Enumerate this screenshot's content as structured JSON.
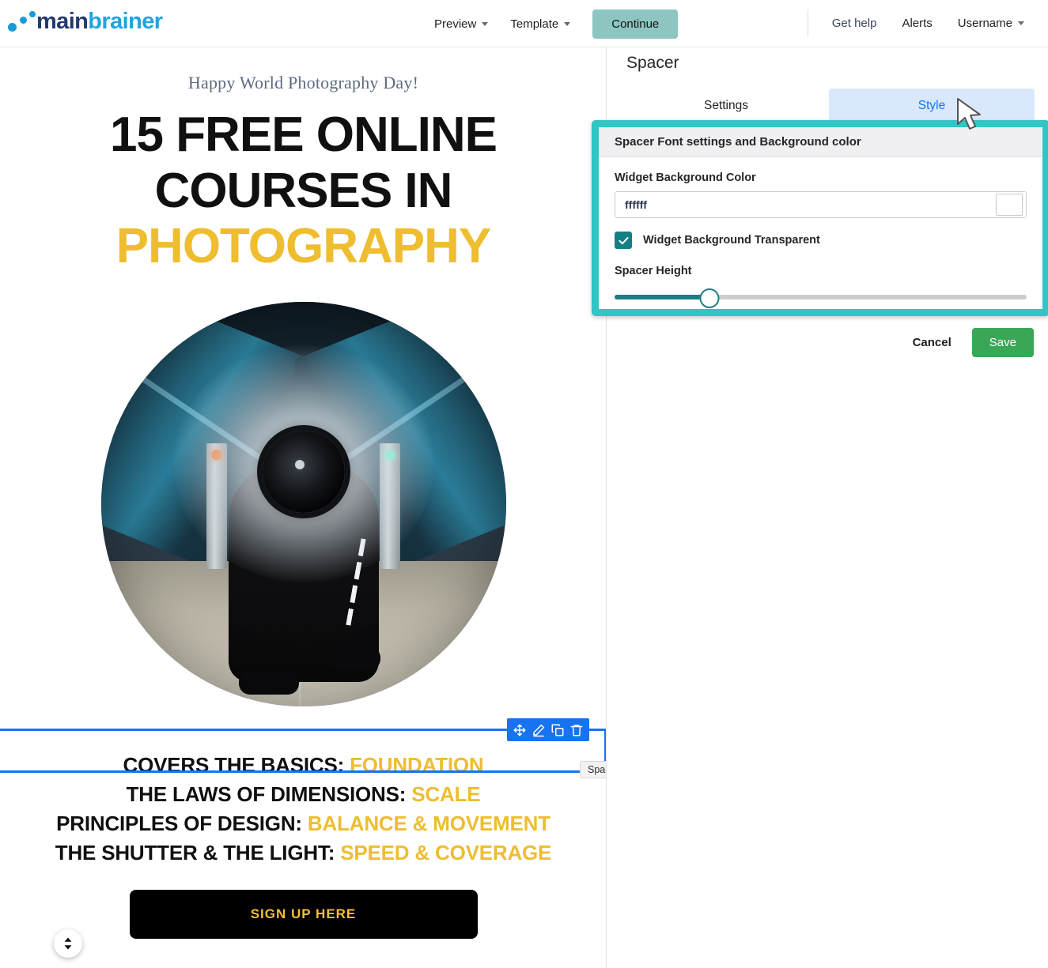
{
  "brand": {
    "name_part1": "main",
    "name_part2": "brainer",
    "dot_color": "#1a9bd7",
    "navy": "#233a6c",
    "blue": "#1fa5e0"
  },
  "topnav": {
    "preview_label": "Preview",
    "template_label": "Template",
    "continue_label": "Continue",
    "continue_bg": "#8dc6c0",
    "get_help_label": "Get help",
    "alerts_label": "Alerts",
    "username_label": "Username"
  },
  "email": {
    "kicker": "Happy World Photography Day!",
    "headline_line1": "15 FREE ONLINE",
    "headline_line2": "COURSES IN",
    "headline_line3": "PHOTOGRAPHY",
    "gold": "#eebd30",
    "photo_alt": "photographer-crouching-in-metro-station",
    "bullets": [
      {
        "dark": "COVERS THE BASICS:",
        "gold": "FOUNDATION"
      },
      {
        "dark": "THE LAWS OF DIMENSIONS:",
        "gold": "SCALE"
      },
      {
        "dark": "PRINCIPLES OF DESIGN:",
        "gold": "BALANCE & MOVEMENT"
      },
      {
        "dark": "THE SHUTTER & THE LIGHT:",
        "gold": "SPEED & COVERAGE"
      }
    ],
    "cta_label": "SIGN UP HERE"
  },
  "selection": {
    "widget_label": "Spacer",
    "outline_color": "#1773f0",
    "toolbar_icons": [
      "move-icon",
      "edit-pencil-icon",
      "duplicate-icon",
      "trash-icon"
    ]
  },
  "panel": {
    "title": "Spacer",
    "tabs": [
      {
        "label": "Settings",
        "active": false
      },
      {
        "label": "Style",
        "active": true
      }
    ],
    "card_header": "Spacer Font settings and Background color",
    "highlight_color": "#31c6c6",
    "bg_color_label": "Widget Background Color",
    "bg_color_value": "ffffff",
    "bg_swatch_color": "#ffffff",
    "transparent_label": "Widget Background Transparent",
    "transparent_checked": true,
    "checkbox_color": "#167f84",
    "spacer_height_label": "Spacer Height",
    "spacer_height_percent": 23,
    "cancel_label": "Cancel",
    "save_label": "Save",
    "save_bg": "#3aa757"
  }
}
